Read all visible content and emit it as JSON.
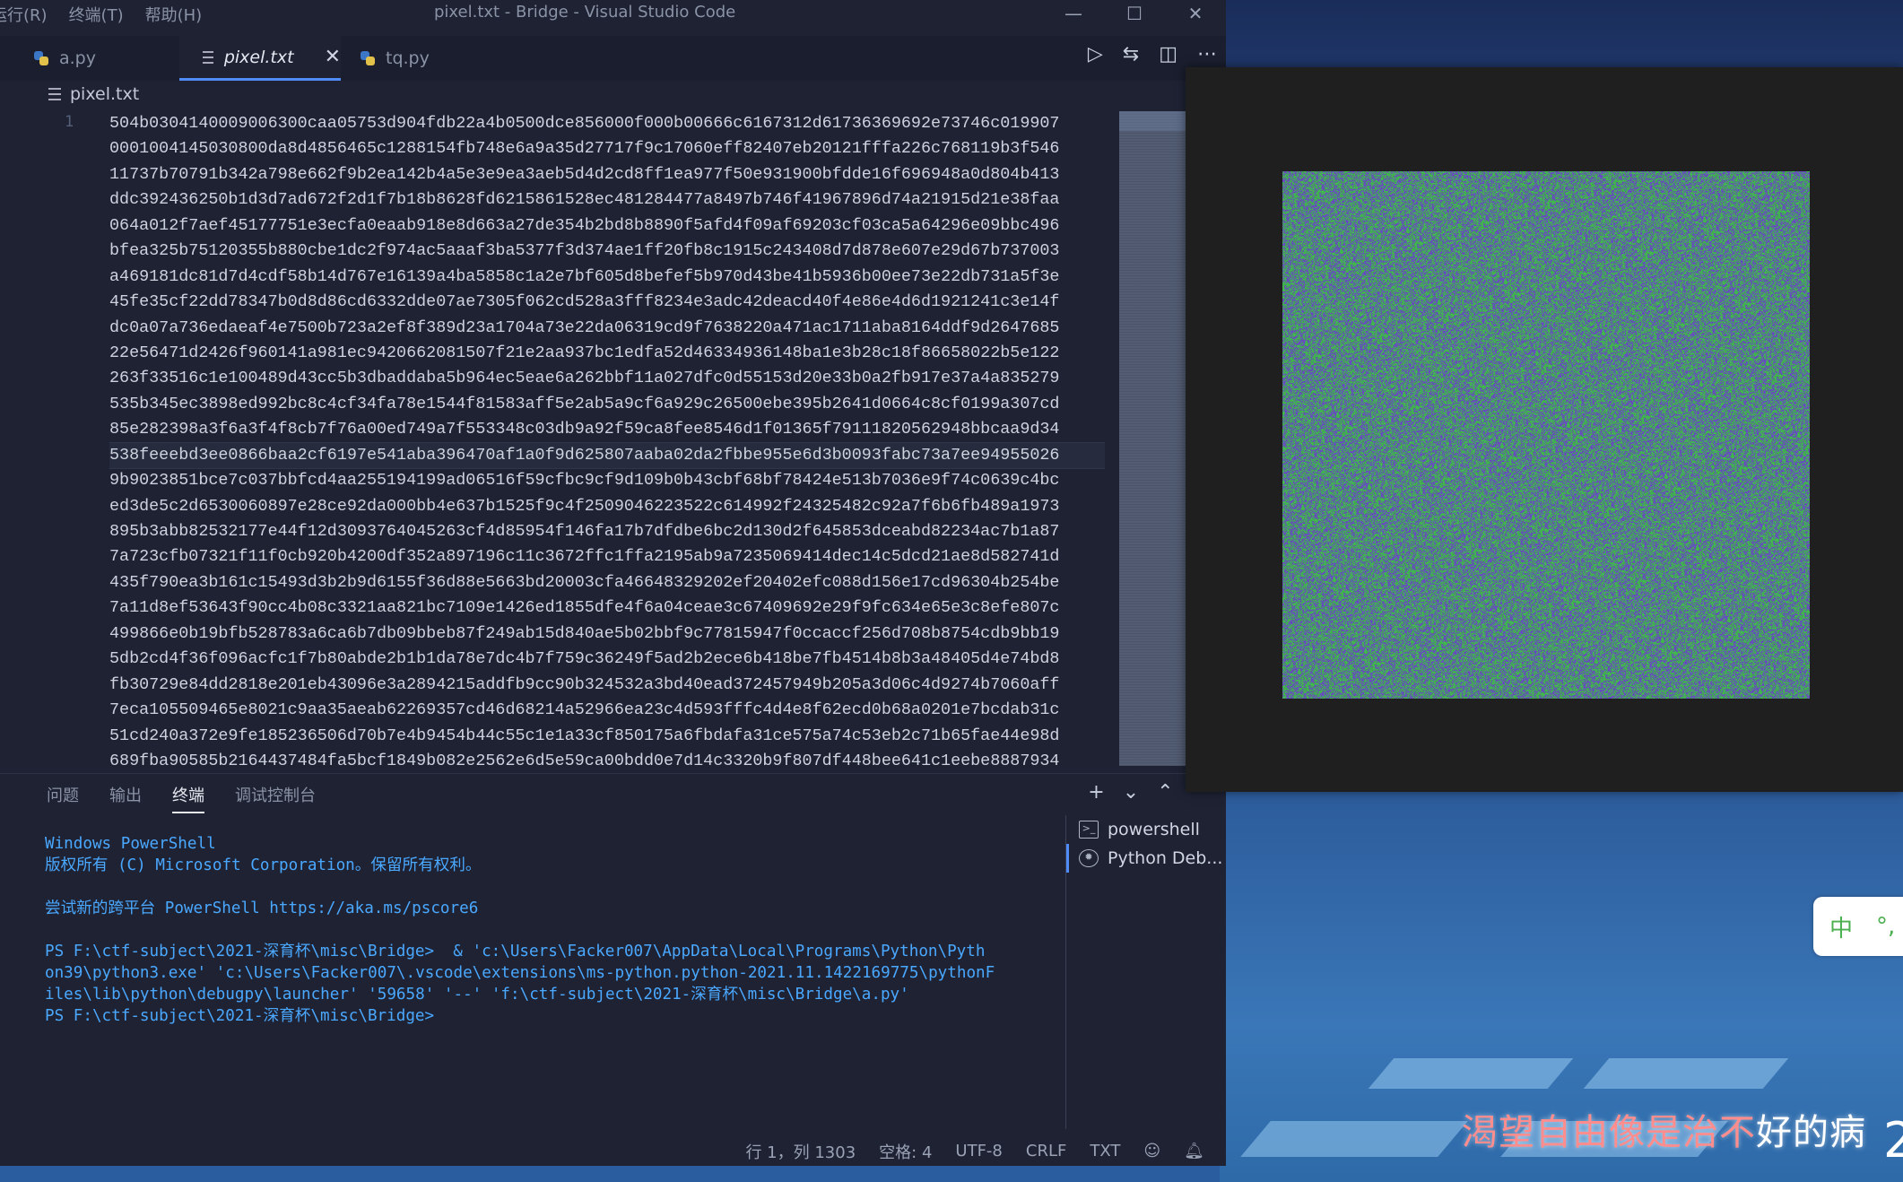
{
  "titlebar": {
    "menu": [
      "运行(R)",
      "终端(T)",
      "帮助(H)"
    ],
    "title": "pixel.txt - Bridge - Visual Studio Code",
    "min": "—",
    "max": "☐",
    "close": "✕"
  },
  "tabs": [
    {
      "label": "a.py",
      "type": "python"
    },
    {
      "label": "pixel.txt",
      "type": "text",
      "active": true
    },
    {
      "label": "tq.py",
      "type": "python"
    }
  ],
  "editor_actions": {
    "run": "▷",
    "compare": "⇆",
    "split": "◫",
    "more": "⋯"
  },
  "breadcrumb": {
    "file": "pixel.txt"
  },
  "editor": {
    "line_number": "1",
    "current_line_index": 13,
    "lines": [
      "504b0304140009006300caa05753d904fdb22a4b0500dce856000f000b00666c6167312d61736369692e73746c019907",
      "0001004145030800da8d4856465c1288154fb748e6a9a35d27717f9c17060eff82407eb20121fffa226c768119b3f546",
      "11737b70791b342a798e662f9b2ea142b4a5e3e9ea3aeb5d4d2cd8ff1ea977f50e931900bfdde16f696948a0d804b413",
      "ddc392436250b1d3d7ad672f2d1f7b18b8628fd6215861528ec481284477a8497b746f41967896d74a21915d21e38faa",
      "064a012f7aef45177751e3ecfa0eaab918e8d663a27de354b2bd8b8890f5afd4f09af69203cf03ca5a64296e09bbc496",
      "bfea325b75120355b880cbe1dc2f974ac5aaaf3ba5377f3d374ae1ff20fb8c1915c243408d7d878e607e29d67b737003",
      "a469181dc81d7d4cdf58b14d767e16139a4ba5858c1a2e7bf605d8befef5b970d43be41b5936b00ee73e22db731a5f3e",
      "45fe35cf22dd78347b0d8d86cd6332dde07ae7305f062cd528a3fff8234e3adc42deacd40f4e86e4d6d1921241c3e14f",
      "dc0a07a736edaeaf4e7500b723a2ef8f389d23a1704a73e22da06319cd9f7638220a471ac1711aba8164ddf9d2647685",
      "22e56471d2426f960141a981ec9420662081507f21e2aa937bc1edfa52d46334936148ba1e3b28c18f86658022b5e122",
      "263f33516c1e100489d43cc5b3dbaddaba5b964ec5eae6a262bbf11a027dfc0d55153d20e33b0a2fb917e37a4a835279",
      "535b345ec3898ed992bc8c4cf34fa78e1544f81583aff5e2ab5a9cf6a929c26500ebe395b2641d0664c8cf0199a307cd",
      "85e282398a3f6a3f4f8cb7f76a00ed749a7f553348c03db9a92f59ca8fee8546d1f01365f79111820562948bbcaa9d34",
      "538feeebd3ee0866baa2cf6197e541aba396470af1a0f9d625807aaba02da2fbbe955e6d3b0093fabc73a7ee94955026",
      "9b9023851bce7c037bbfcd4aa255194199ad06516f59cfbc9cf9d109b0b43cbf68bf78424e513b7036e9f74c0639c4bc",
      "ed3de5c2d6530060897e28ce92da000bb4e637b1525f9c4f2509046223522c614992f24325482c92a7f6b6fb489a1973",
      "895b3abb82532177e44f12d3093764045263cf4d85954f146fa17b7dfdbe6bc2d130d2f645853dceabd82234ac7b1a87",
      "7a723cfb07321f11f0cb920b4200df352a897196c11c3672ffc1ffa2195ab9a7235069414dec14c5dcd21ae8d582741d",
      "435f790ea3b161c15493d3b2b9d6155f36d88e5663bd20003cfa46648329202ef20402efc088d156e17cd96304b254be",
      "7a11d8ef53643f90cc4b08c3321aa821bc7109e1426ed1855dfe4f6a04ceae3c67409692e29f9fc634e65e3c8efe807c",
      "499866e0b19bfb528783a6ca6b7db09bbeb87f249ab15d840ae5b02bbf9c77815947f0ccaccf256d708b8754cdb9bb19",
      "5db2cd4f36f096acfc1f7b80abde2b1b1da78e7dc4b7f759c36249f5ad2b2ece6b418be7fb4514b8b3a48405d4e74bd8",
      "fb30729e84dd2818e201eb43096e3a2894215addfb9cc90b324532a3bd40ead372457949b205a3d06c4d9274b7060aff",
      "7eca105509465e8021c9aa35aeab62269357cd46d68214a52966ea23c4d593fffc4d4e8f62ecd0b68a0201e7bcdab31c",
      "51cd240a372e9fe185236506d70b7e4b9454b44c55c1e1a33cf850175a6fbdafa31ce575a74c53eb2c71b65fae44e98d",
      "689fba90585b2164437484fa5bcf1849b082e2562e6d5e59ca00bdd0e7d14c3320b9f807df448bee641c1eebe8887934"
    ]
  },
  "panel": {
    "tabs": [
      "问题",
      "输出",
      "终端",
      "调试控制台"
    ],
    "active_tab": "终端",
    "actions": {
      "add": "+",
      "dropdown": "⌄",
      "maximize": "⌃",
      "close": "⌃"
    },
    "terminal_lines": [
      "Windows PowerShell",
      "版权所有 (C) Microsoft Corporation。保留所有权利。",
      "",
      "尝试新的跨平台 PowerShell https://aka.ms/pscore6",
      "",
      "PS F:\\ctf-subject\\2021-深育杯\\misc\\Bridge>  & 'c:\\Users\\Facker007\\AppData\\Local\\Programs\\Python\\Pyth",
      "on39\\python3.exe' 'c:\\Users\\Facker007\\.vscode\\extensions\\ms-python.python-2021.11.1422169775\\pythonF",
      "iles\\lib\\python\\debugpy\\launcher' '59658' '--' 'f:\\ctf-subject\\2021-深育杯\\misc\\Bridge\\a.py'",
      "PS F:\\ctf-subject\\2021-深育杯\\misc\\Bridge>"
    ],
    "terminal_list": [
      "powershell",
      "Python Deb..."
    ]
  },
  "statusbar": {
    "position": "行 1，列 1303",
    "spaces": "空格: 4",
    "encoding": "UTF-8",
    "eol": "CRLF",
    "language": "TXT"
  },
  "viewer": {
    "colors": {
      "green": "#3fa84a",
      "purple": "#6a45c8",
      "bg": "#1f1f1f"
    }
  },
  "wallpaper": {
    "lyric_red": "渴望自由像是治不",
    "lyric_white": "好的病",
    "corner": "2",
    "ime": [
      "中",
      "°,"
    ]
  }
}
